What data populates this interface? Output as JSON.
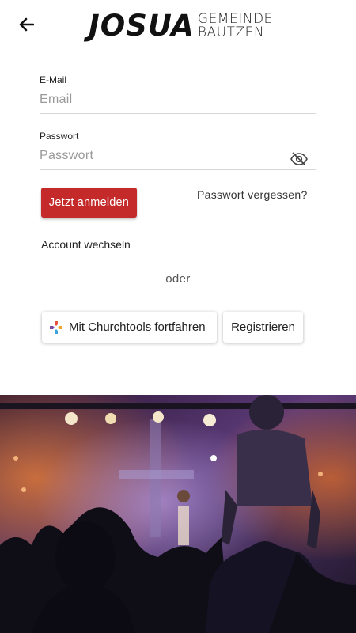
{
  "header": {
    "back_icon": "arrow-left-icon",
    "logo_main": "JOSUA",
    "logo_line1": "GEMEINDE",
    "logo_line2": "BAUTZEN"
  },
  "form": {
    "email": {
      "label": "E-Mail",
      "placeholder": "Email",
      "value": ""
    },
    "password": {
      "label": "Passwort",
      "placeholder": "Passwort",
      "value": "",
      "toggle_icon": "eye-off-icon"
    },
    "login_label": "Jetzt anmelden",
    "forgot_label": "Passwort vergessen?",
    "switch_account_label": "Account wechseln",
    "divider_text": "oder",
    "churchtools_label": "Mit Churchtools fortfahren",
    "churchtools_icon": "churchtools-logo-icon",
    "register_label": "Registrieren"
  },
  "colors": {
    "primary": "#c42a2a",
    "text": "#222222",
    "placeholder": "#9a9a9a",
    "divider": "#e3e3e3"
  },
  "hero_image": "concert-crowd-photo"
}
